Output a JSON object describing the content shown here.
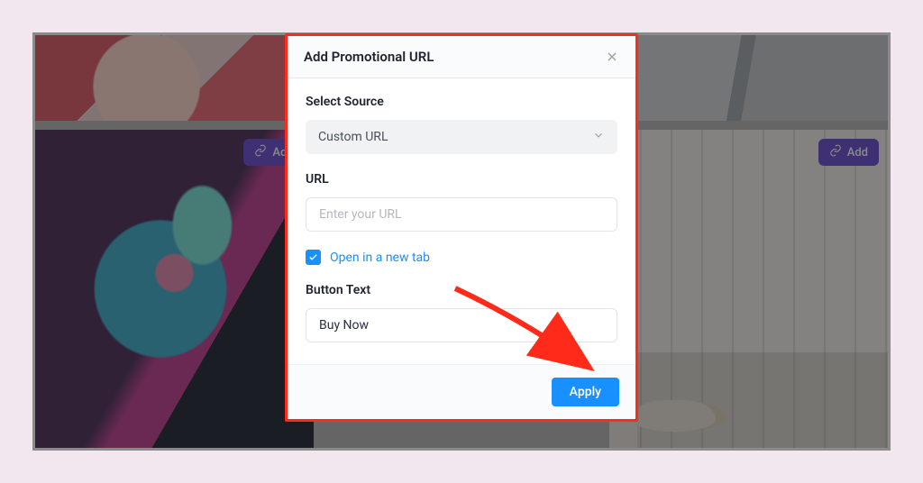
{
  "modal": {
    "title": "Add Promotional URL",
    "source_label": "Select Source",
    "source_value": "Custom URL",
    "url_label": "URL",
    "url_placeholder": "Enter your URL",
    "newtab_label": "Open in a new tab",
    "btntext_label": "Button Text",
    "btntext_value": "Buy Now",
    "apply_label": "Apply"
  },
  "gallery": {
    "add_label": "Add"
  }
}
